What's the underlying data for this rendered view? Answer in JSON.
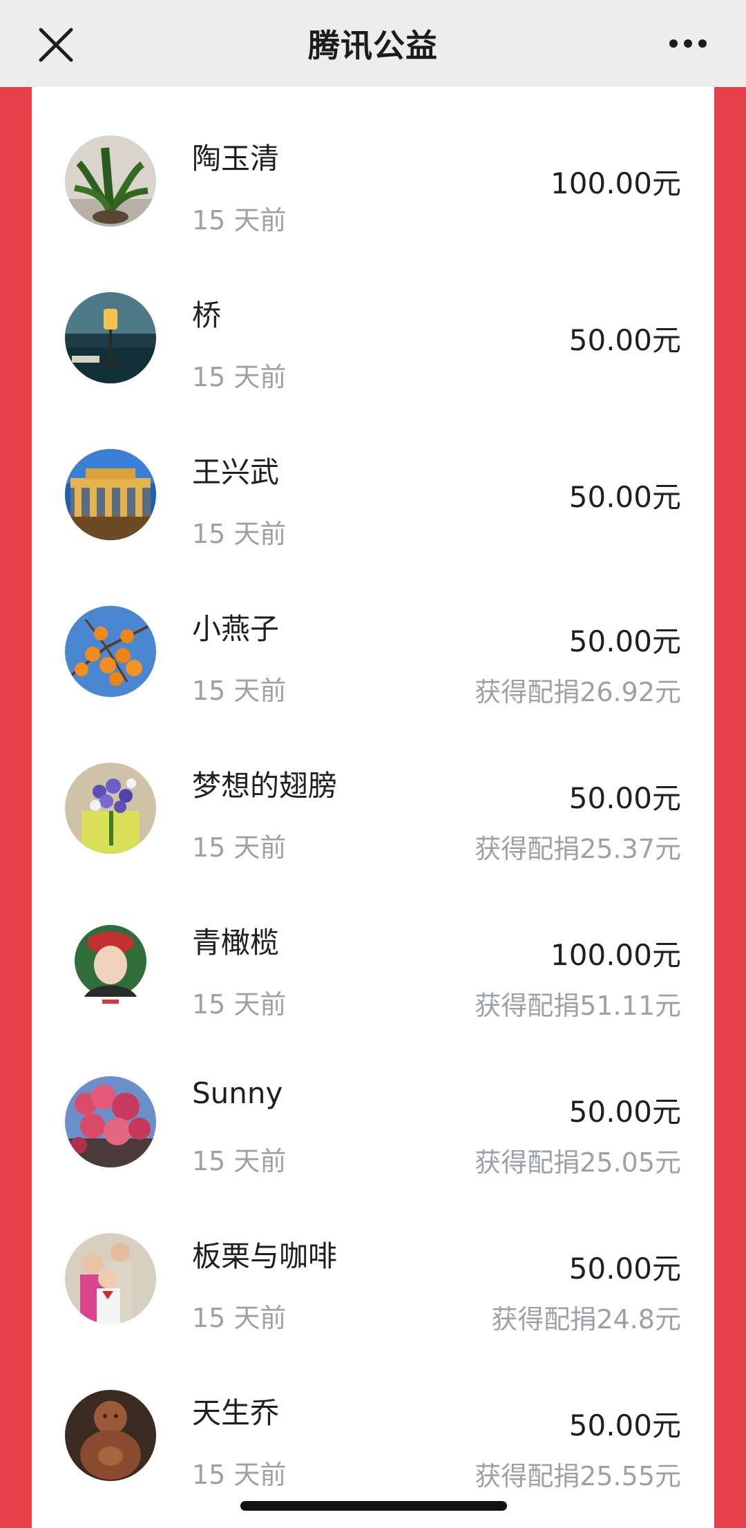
{
  "header": {
    "title": "腾讯公益",
    "close_icon": "close-icon",
    "more_icon": "more-icon"
  },
  "donations": [
    {
      "name": "陶玉清",
      "time": "15 天前",
      "amount": "100.00元",
      "match": ""
    },
    {
      "name": "桥",
      "time": "15 天前",
      "amount": "50.00元",
      "match": ""
    },
    {
      "name": "王兴武",
      "time": "15 天前",
      "amount": "50.00元",
      "match": ""
    },
    {
      "name": "小燕子",
      "time": "15 天前",
      "amount": "50.00元",
      "match": "获得配捐26.92元"
    },
    {
      "name": "梦想的翅膀",
      "time": "15 天前",
      "amount": "50.00元",
      "match": "获得配捐25.37元"
    },
    {
      "name": "青橄榄",
      "time": "15 天前",
      "amount": "100.00元",
      "match": "获得配捐51.11元"
    },
    {
      "name": "Sunny",
      "time": "15 天前",
      "amount": "50.00元",
      "match": "获得配捐25.05元"
    },
    {
      "name": "板栗与咖啡",
      "time": "15 天前",
      "amount": "50.00元",
      "match": "获得配捐24.8元"
    },
    {
      "name": "天生乔",
      "time": "15 天前",
      "amount": "50.00元",
      "match": "获得配捐25.55元"
    }
  ],
  "colors": {
    "side_background": "#e8404b",
    "panel": "#ffffff",
    "primary_text": "#1f1f1f",
    "secondary_text": "#9da1a5"
  }
}
